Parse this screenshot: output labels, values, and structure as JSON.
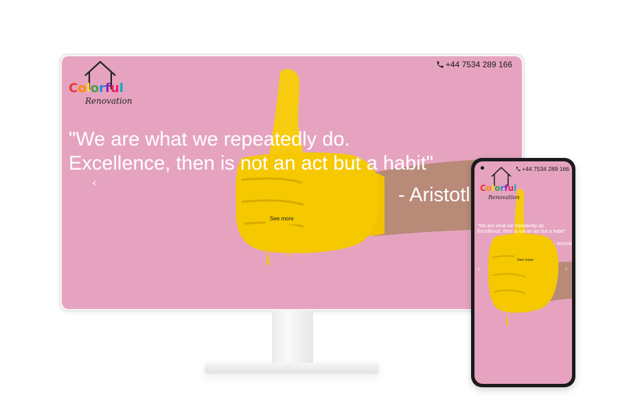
{
  "site": {
    "phone_number": "+44 7534 289 166",
    "logo": {
      "brand_word_letters": [
        "C",
        "o",
        "l",
        "o",
        "r",
        "f",
        "u",
        "l"
      ],
      "brand_word_colors": [
        "#e53935",
        "#fb8c00",
        "#fdd835",
        "#43a047",
        "#1e88e5",
        "#8e24aa",
        "#e91e63",
        "#00acc1"
      ],
      "tagline": "Renovation"
    },
    "hero": {
      "quote_line1": "\"We are what we repeatedly do.",
      "quote_line2": "Excellence, then is not an act but a habit\"",
      "author": "- Aristotle",
      "button_label": "See more",
      "prev_arrow": "‹",
      "next_arrow": "›"
    }
  },
  "colors": {
    "hero_background": "#e6a3c0",
    "paint_yellow": "#f5c800",
    "button_yellow": "#f5c800"
  },
  "icons": [
    "phone-icon",
    "house-outline-icon",
    "chevron-left-icon",
    "chevron-right-icon"
  ]
}
